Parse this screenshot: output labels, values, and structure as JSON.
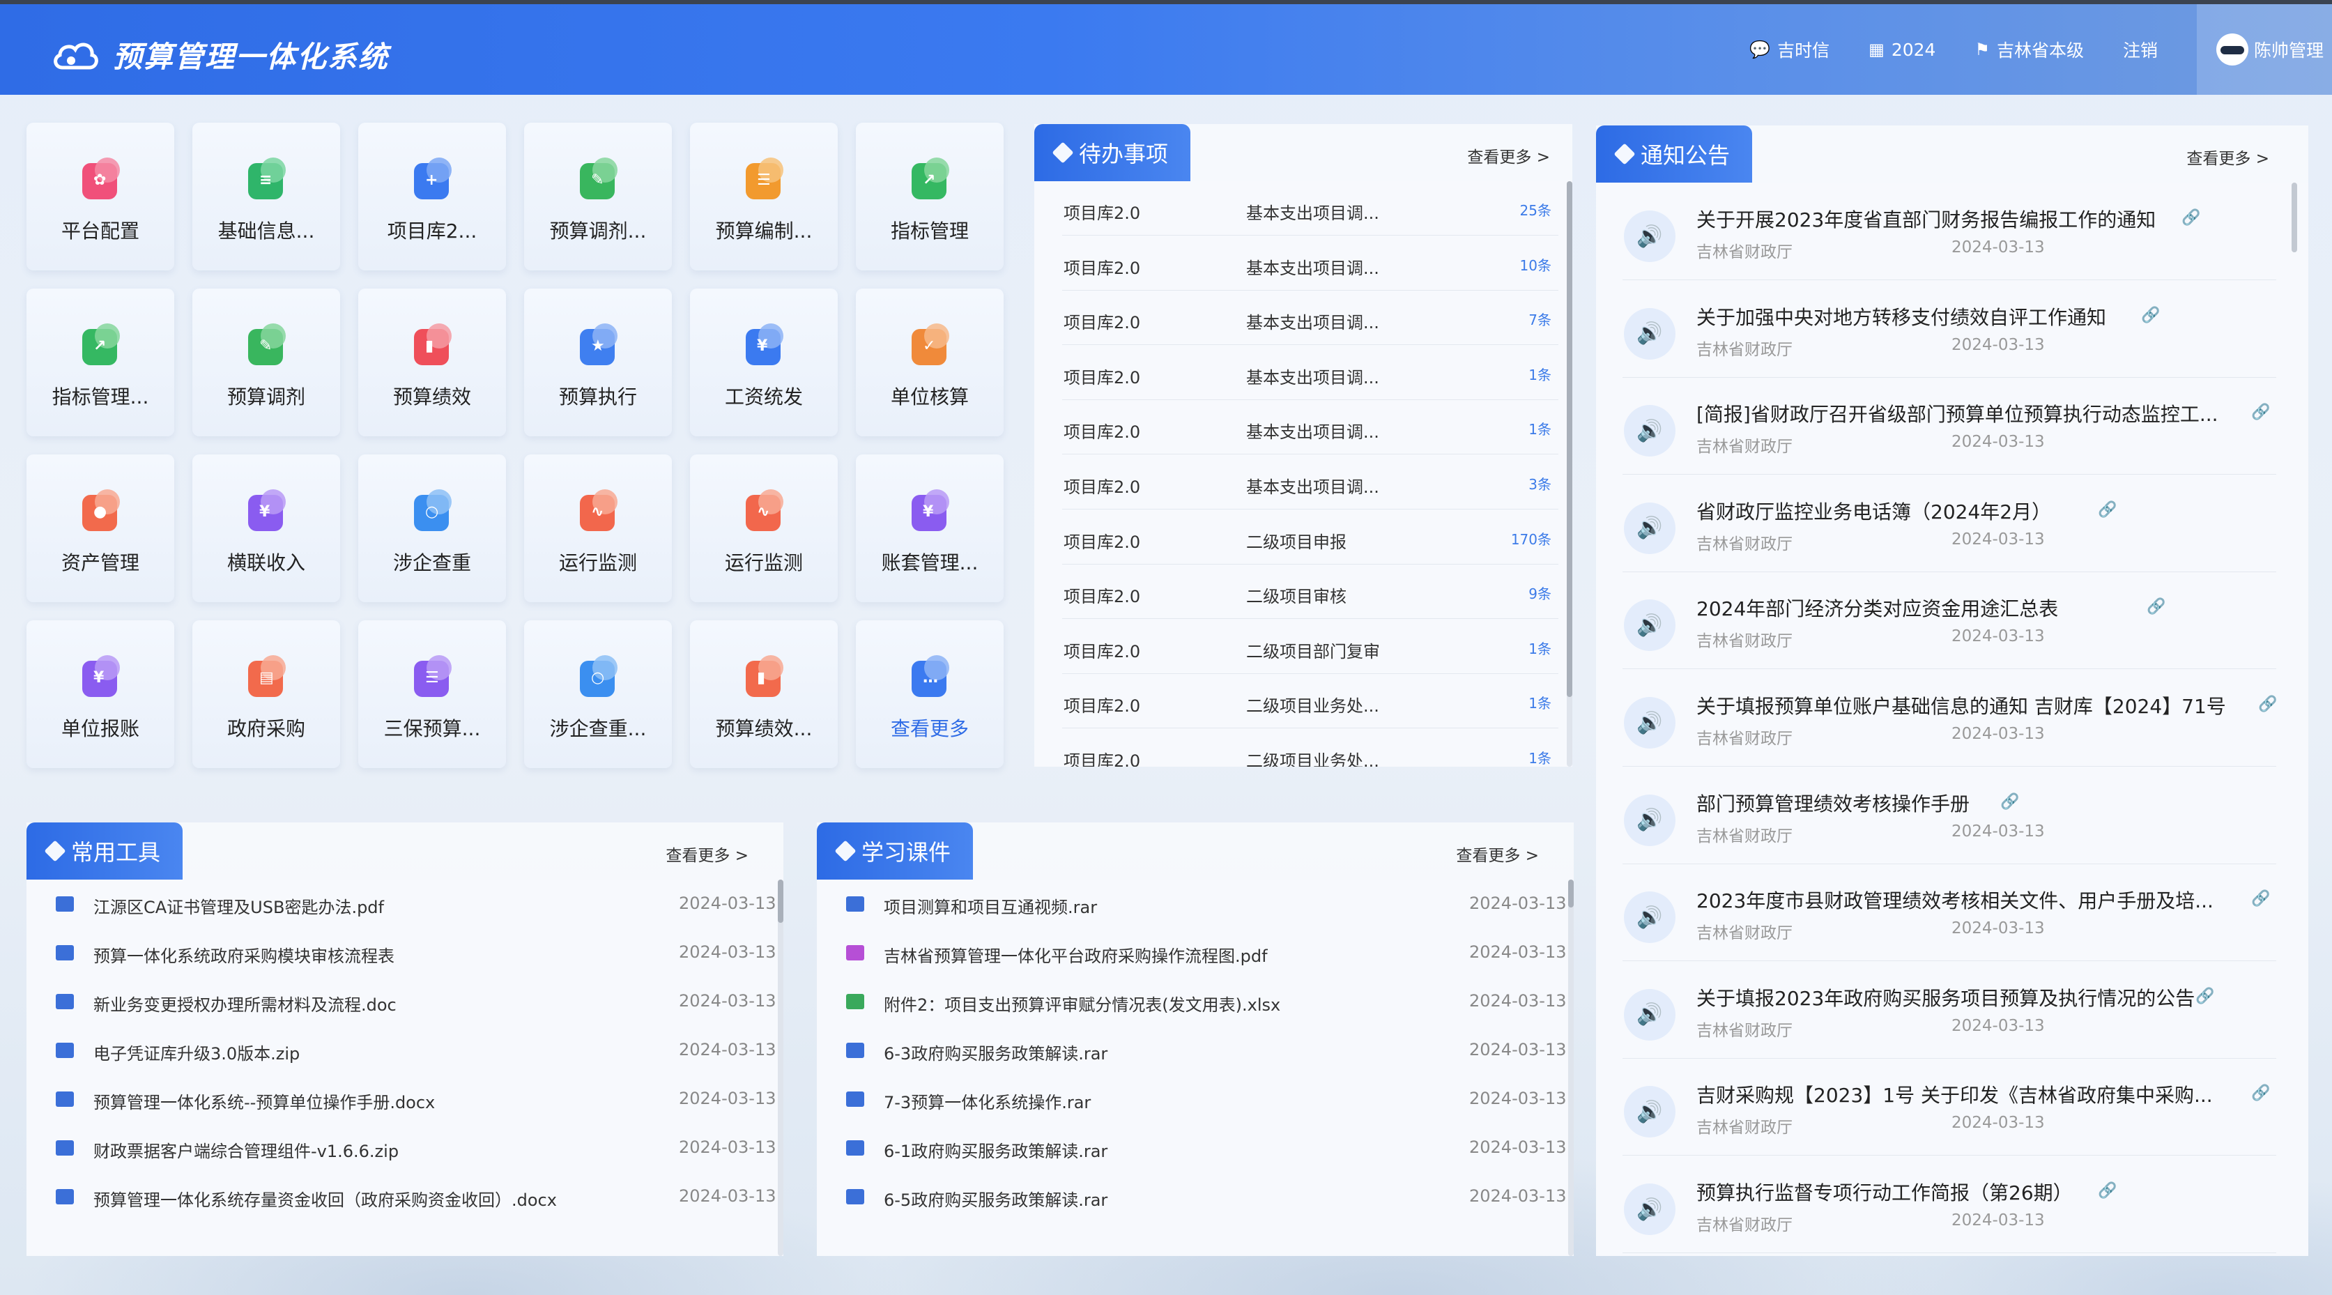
{
  "header": {
    "title": "预算管理一体化系统",
    "nav": [
      {
        "icon": "chat-icon",
        "label": "吉时信"
      },
      {
        "icon": "calendar-icon",
        "label": "2024"
      },
      {
        "icon": "flag-icon",
        "label": "吉林省本级"
      },
      {
        "icon": "",
        "label": "注销"
      }
    ],
    "user": "陈帅管理"
  },
  "apps": [
    {
      "label": "平台配置",
      "color": "#f0507a",
      "color2": "#f58aa4",
      "glyph": "✿"
    },
    {
      "label": "基础信息...",
      "color": "#2fb56a",
      "color2": "#7bd6a1",
      "glyph": "≡"
    },
    {
      "label": "项目库2...",
      "color": "#3b7af0",
      "color2": "#7ea8f5",
      "glyph": "+"
    },
    {
      "label": "预算调剂...",
      "color": "#39b65e",
      "color2": "#86d69c",
      "glyph": "✎"
    },
    {
      "label": "预算编制...",
      "color": "#f29a2e",
      "color2": "#f7c27a",
      "glyph": "☰"
    },
    {
      "label": "指标管理",
      "color": "#35b862",
      "color2": "#86d69c",
      "glyph": "↗"
    },
    {
      "label": "指标管理...",
      "color": "#35b862",
      "color2": "#86d69c",
      "glyph": "↗"
    },
    {
      "label": "预算调剂",
      "color": "#39b65e",
      "color2": "#86d69c",
      "glyph": "✎"
    },
    {
      "label": "预算绩效",
      "color": "#ef4f5a",
      "color2": "#f59ba3",
      "glyph": "▮"
    },
    {
      "label": "预算执行",
      "color": "#3f7ff0",
      "color2": "#8db3f6",
      "glyph": "★"
    },
    {
      "label": "工资统发",
      "color": "#3b7af0",
      "color2": "#8db3f6",
      "glyph": "¥"
    },
    {
      "label": "单位核算",
      "color": "#f08a3a",
      "color2": "#f7b98a",
      "glyph": "✓"
    },
    {
      "label": "资产管理",
      "color": "#f26a4c",
      "color2": "#f8a993",
      "glyph": "●"
    },
    {
      "label": "横联收入",
      "color": "#8a5cf0",
      "color2": "#b99af6",
      "glyph": "¥"
    },
    {
      "label": "涉企查重",
      "color": "#3b8ff0",
      "color2": "#8dc0f6",
      "glyph": "○"
    },
    {
      "label": "运行监测",
      "color": "#f2674c",
      "color2": "#f8a993",
      "glyph": "∿"
    },
    {
      "label": "运行监测",
      "color": "#f2674c",
      "color2": "#f8a993",
      "glyph": "∿"
    },
    {
      "label": "账套管理...",
      "color": "#8a5cf0",
      "color2": "#b99af6",
      "glyph": "¥"
    },
    {
      "label": "单位报账",
      "color": "#8a5cf0",
      "color2": "#b99af6",
      "glyph": "¥"
    },
    {
      "label": "政府采购",
      "color": "#f26a4c",
      "color2": "#f8a993",
      "glyph": "▤"
    },
    {
      "label": "三保预算...",
      "color": "#8a5cf0",
      "color2": "#b99af6",
      "glyph": "☰"
    },
    {
      "label": "涉企查重...",
      "color": "#3b8ff0",
      "color2": "#8dc0f6",
      "glyph": "○"
    },
    {
      "label": "预算绩效...",
      "color": "#f26a4c",
      "color2": "#f8a993",
      "glyph": "▮"
    },
    {
      "label": "查看更多",
      "color": "#3b7af0",
      "color2": "#8db3f6",
      "glyph": "…"
    }
  ],
  "todo": {
    "title": "待办事项",
    "more": "查看更多 >",
    "items": [
      {
        "module": "项目库2.0",
        "task": "基本支出项目调...",
        "count": "25条"
      },
      {
        "module": "项目库2.0",
        "task": "基本支出项目调...",
        "count": "10条"
      },
      {
        "module": "项目库2.0",
        "task": "基本支出项目调...",
        "count": "7条"
      },
      {
        "module": "项目库2.0",
        "task": "基本支出项目调...",
        "count": "1条"
      },
      {
        "module": "项目库2.0",
        "task": "基本支出项目调...",
        "count": "1条"
      },
      {
        "module": "项目库2.0",
        "task": "基本支出项目调...",
        "count": "3条"
      },
      {
        "module": "项目库2.0",
        "task": "二级项目申报",
        "count": "170条"
      },
      {
        "module": "项目库2.0",
        "task": "二级项目审核",
        "count": "9条"
      },
      {
        "module": "项目库2.0",
        "task": "二级项目部门复审",
        "count": "1条"
      },
      {
        "module": "项目库2.0",
        "task": "二级项目业务处...",
        "count": "1条"
      },
      {
        "module": "项目库2.0",
        "task": "二级项目业务处...",
        "count": "1条"
      }
    ]
  },
  "notices": {
    "title": "通知公告",
    "more": "查看更多 >",
    "items": [
      {
        "title": "关于开展2023年度省直部门财务报告编报工作的通知",
        "source": "吉林省财政厅",
        "date": "2024-03-13"
      },
      {
        "title": "关于加强中央对地方转移支付绩效自评工作通知",
        "source": "吉林省财政厅",
        "date": "2024-03-13"
      },
      {
        "title": "[简报]省财政厅召开省级部门预算单位预算执行动态监控工...",
        "source": "吉林省财政厅",
        "date": "2024-03-13"
      },
      {
        "title": "省财政厅监控业务电话簿（2024年2月）",
        "source": "吉林省财政厅",
        "date": "2024-03-13"
      },
      {
        "title": "2024年部门经济分类对应资金用途汇总表",
        "source": "吉林省财政厅",
        "date": "2024-03-13"
      },
      {
        "title": "关于填报预算单位账户基础信息的通知 吉财库【2024】71号",
        "source": "吉林省财政厅",
        "date": "2024-03-13"
      },
      {
        "title": "部门预算管理绩效考核操作手册",
        "source": "吉林省财政厅",
        "date": "2024-03-13"
      },
      {
        "title": "2023年度市县财政管理绩效考核相关文件、用户手册及培...",
        "source": "吉林省财政厅",
        "date": "2024-03-13"
      },
      {
        "title": "关于填报2023年政府购买服务项目预算及执行情况的公告",
        "source": "吉林省财政厅",
        "date": "2024-03-13"
      },
      {
        "title": "吉财采购规【2023】1号 关于印发《吉林省政府集中采购...",
        "source": "吉林省财政厅",
        "date": "2024-03-13"
      },
      {
        "title": "预算执行监督专项行动工作简报（第26期）",
        "source": "吉林省财政厅",
        "date": "2024-03-13"
      }
    ]
  },
  "tools": {
    "title": "常用工具",
    "more": "查看更多 >",
    "items": [
      {
        "name": "江源区CA证书管理及USB密匙办法.pdf",
        "date": "2024-03-13"
      },
      {
        "name": "预算一体化系统政府采购模块审核流程表",
        "date": "2024-03-13"
      },
      {
        "name": "新业务变更授权办理所需材料及流程.doc",
        "date": "2024-03-13"
      },
      {
        "name": "电子凭证库升级3.0版本.zip",
        "date": "2024-03-13"
      },
      {
        "name": "预算管理一体化系统--预算单位操作手册.docx",
        "date": "2024-03-13"
      },
      {
        "name": "财政票据客户端综合管理组件-v1.6.6.zip",
        "date": "2024-03-13"
      },
      {
        "name": "预算管理一体化系统存量资金收回（政府采购资金收回）.docx",
        "date": "2024-03-13"
      }
    ]
  },
  "courses": {
    "title": "学习课件",
    "more": "查看更多 >",
    "items": [
      {
        "name": "项目测算和项目互通视频.rar",
        "date": "2024-03-13",
        "color": "#3b6fd8"
      },
      {
        "name": "吉林省预算管理一体化平台政府采购操作流程图.pdf",
        "date": "2024-03-13",
        "color": "#b64fd6"
      },
      {
        "name": "附件2：项目支出预算评审赋分情况表(发文用表).xlsx",
        "date": "2024-03-13",
        "color": "#3aa95c"
      },
      {
        "name": "6-3政府购买服务政策解读.rar",
        "date": "2024-03-13",
        "color": "#3b6fd8"
      },
      {
        "name": "7-3预算一体化系统操作.rar",
        "date": "2024-03-13",
        "color": "#3b6fd8"
      },
      {
        "name": "6-1政府购买服务政策解读.rar",
        "date": "2024-03-13",
        "color": "#3b6fd8"
      },
      {
        "name": "6-5政府购买服务政策解读.rar",
        "date": "2024-03-13",
        "color": "#3b6fd8"
      }
    ]
  }
}
